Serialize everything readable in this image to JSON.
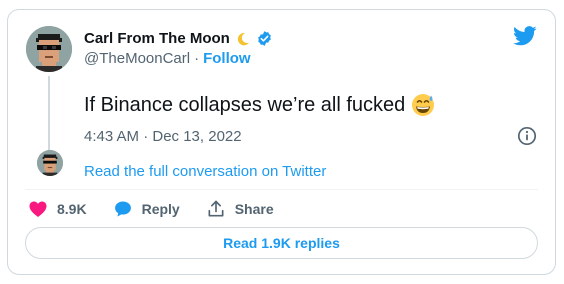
{
  "author": {
    "display_name": "Carl From The Moon",
    "handle": "@TheMoonCarl",
    "follow_label": "Follow",
    "separator": "·"
  },
  "tweet": {
    "text": "If Binance collapses we’re all fucked",
    "timestamp": "4:43 AM · Dec 13, 2022"
  },
  "conversation_link": "Read the full conversation on Twitter",
  "actions": {
    "likes": "8.9K",
    "reply_label": "Reply",
    "share_label": "Share"
  },
  "read_replies_label": "Read 1.9K replies",
  "icons": {
    "brand": "twitter-bird-icon",
    "verified": "verified-badge-icon",
    "moon": "crescent-moon-icon",
    "emoji": "grinning-sweat-emoji-icon",
    "info": "info-icon",
    "like": "heart-icon",
    "reply": "speech-bubble-icon",
    "share": "share-icon"
  },
  "colors": {
    "accent": "#1d9bf0",
    "like": "#f91880",
    "text": "#0f1419",
    "secondary": "#536471",
    "border": "#cfd9de"
  }
}
